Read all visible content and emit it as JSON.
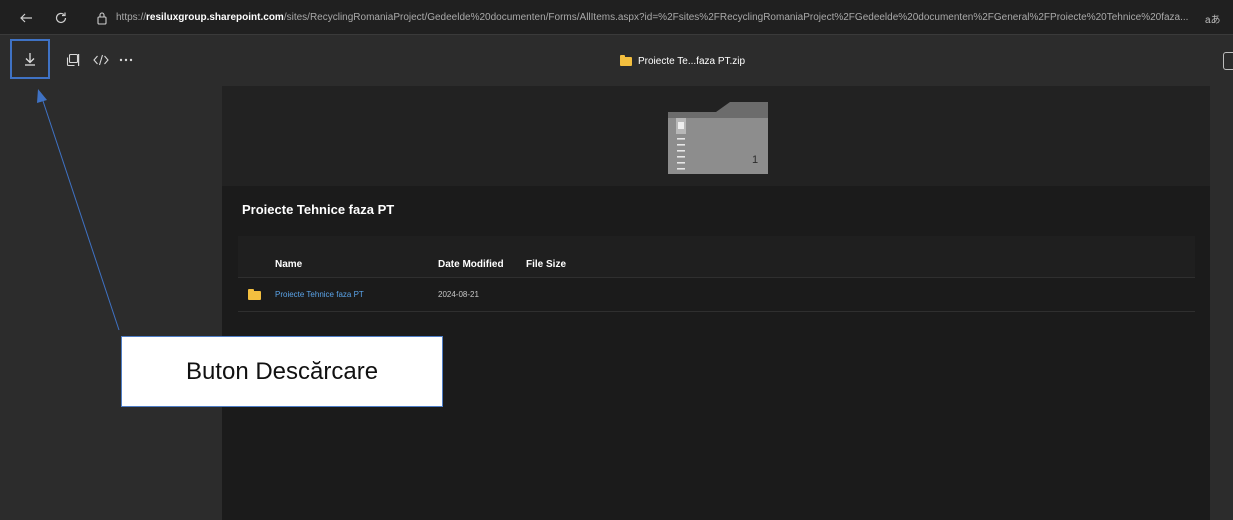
{
  "browser": {
    "url_prefix": "https://",
    "url_host": "resiluxgroup.sharepoint.com",
    "url_path": "/sites/RecyclingRomaniaProject/Gedeelde%20documenten/Forms/AllItems.aspx?id=%2Fsites%2FRecyclingRomaniaProject%2FGedeelde%20documenten%2FGeneral%2FProiecte%20Tehnice%20faza...",
    "reader_label": "aあ"
  },
  "viewer": {
    "file_title": "Proiecte Te...faza PT.zip",
    "zip_item_count": "1"
  },
  "panel": {
    "title": "Proiecte Tehnice faza PT",
    "columns": [
      "Name",
      "Date Modified",
      "File Size"
    ],
    "rows": [
      {
        "name": "Proiecte Tehnice faza PT",
        "date_modified": "2024-08-21",
        "file_size": ""
      }
    ]
  },
  "annotation": {
    "label": "Buton Descărcare",
    "accent_color": "#3f72c4"
  }
}
